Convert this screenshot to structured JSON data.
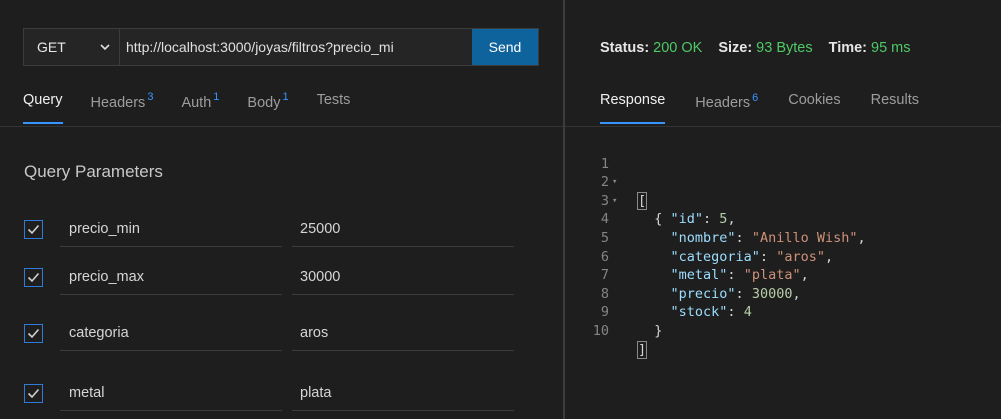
{
  "request": {
    "method": "GET",
    "url": "http://localhost:3000/joyas/filtros?precio_mi",
    "send_label": "Send"
  },
  "request_tabs": [
    {
      "label": "Query",
      "count": ""
    },
    {
      "label": "Headers",
      "count": "3"
    },
    {
      "label": "Auth",
      "count": "1"
    },
    {
      "label": "Body",
      "count": "1"
    },
    {
      "label": "Tests",
      "count": ""
    }
  ],
  "query": {
    "title": "Query Parameters",
    "params": [
      {
        "key": "precio_min",
        "value": "25000",
        "checked": true
      },
      {
        "key": "precio_max",
        "value": "30000",
        "checked": true
      },
      {
        "key": "categoria",
        "value": "aros",
        "checked": true
      },
      {
        "key": "metal",
        "value": "plata",
        "checked": true
      }
    ]
  },
  "response_status": {
    "status_label": "Status:",
    "status_value": "200 OK",
    "size_label": "Size:",
    "size_value": "93 Bytes",
    "time_label": "Time:",
    "time_value": "95 ms"
  },
  "response_tabs": [
    {
      "label": "Response",
      "count": ""
    },
    {
      "label": "Headers",
      "count": "6"
    },
    {
      "label": "Cookies",
      "count": ""
    },
    {
      "label": "Results",
      "count": ""
    }
  ],
  "response_body": {
    "line_numbers": [
      "1",
      "2",
      "3",
      "4",
      "5",
      "6",
      "7",
      "8",
      "9",
      "10"
    ],
    "open_array": "[",
    "open_object": "{",
    "fields": [
      {
        "key": "\"id\"",
        "value": "5",
        "kind": "number"
      },
      {
        "key": "\"nombre\"",
        "value": "\"Anillo Wish\"",
        "kind": "string"
      },
      {
        "key": "\"categoria\"",
        "value": "\"aros\"",
        "kind": "string"
      },
      {
        "key": "\"metal\"",
        "value": "\"plata\"",
        "kind": "string"
      },
      {
        "key": "\"precio\"",
        "value": "30000",
        "kind": "number"
      },
      {
        "key": "\"stock\"",
        "value": "4",
        "kind": "number"
      }
    ],
    "close_object": "}",
    "close_array": "]"
  },
  "colors": {
    "accent": "#3794ff",
    "send_button": "#0e639c",
    "status_green": "#4ec966",
    "json_key": "#9cdcfe",
    "json_string": "#ce9178",
    "json_number": "#b5cea8"
  }
}
